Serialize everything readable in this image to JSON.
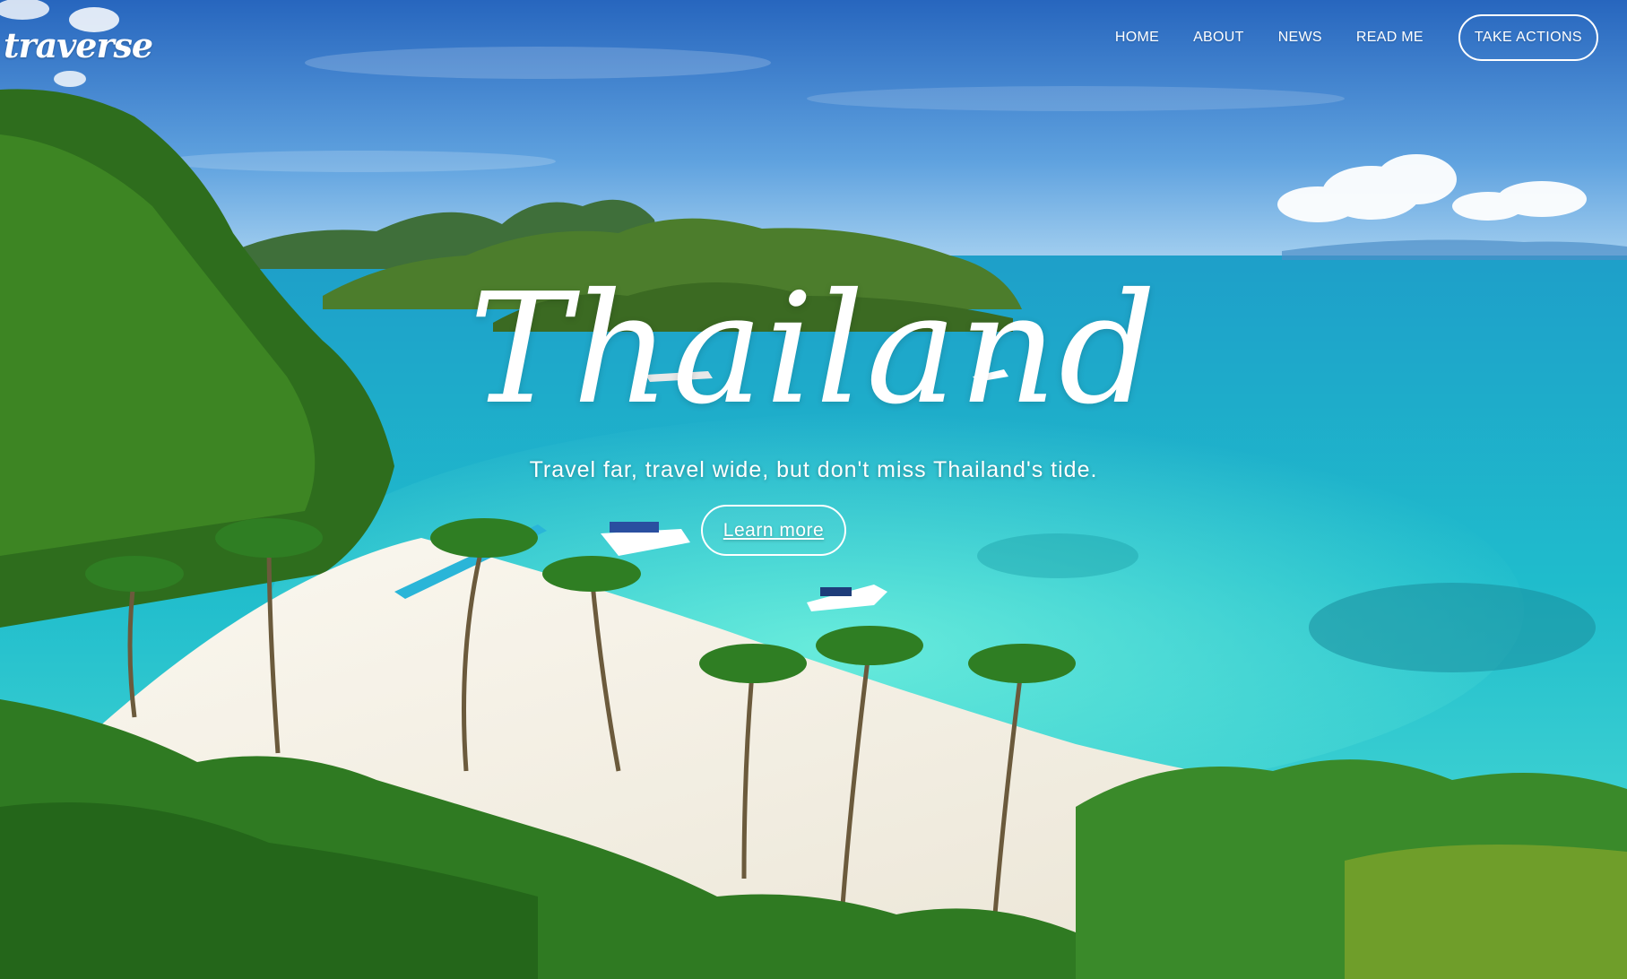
{
  "brand": {
    "logo_text": "traverse"
  },
  "nav": {
    "links": [
      "HOME",
      "ABOUT",
      "NEWS",
      "READ ME"
    ],
    "cta_label": "TAKE ACTIONS"
  },
  "hero": {
    "title": "Thailand",
    "subtitle": "Travel far, travel wide, but don't miss Thailand's tide.",
    "button_label": "Learn more",
    "image": "tropical-beach-photo"
  },
  "colors": {
    "text": "#ffffff",
    "sky_top": "#2b6fc2",
    "sea": "#25c4d4",
    "sand": "#f2efe6",
    "foliage": "#2f7a22"
  }
}
